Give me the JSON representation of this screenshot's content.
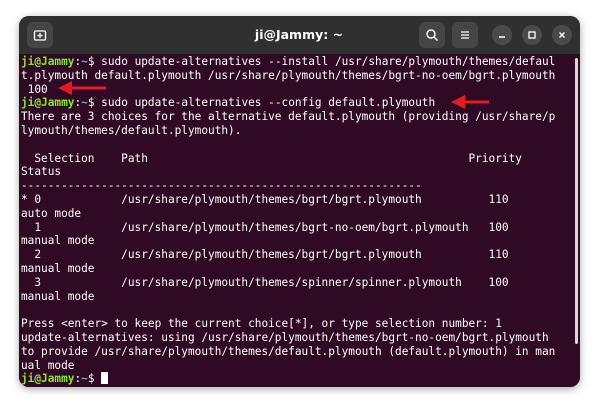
{
  "window": {
    "title": "ji@Jammy: ~"
  },
  "prompt": {
    "user": "ji@Jammy",
    "sep": ":",
    "path": "~",
    "symbol": "$"
  },
  "lines": [
    {
      "type": "cmd",
      "text": " sudo update-alternatives --install /usr/share/plymouth/themes/defaul"
    },
    {
      "type": "out",
      "text": "t.plymouth default.plymouth /usr/share/plymouth/themes/bgrt-no-oem/bgrt.plymouth"
    },
    {
      "type": "out",
      "text": " 100"
    },
    {
      "type": "cmd",
      "text": " sudo update-alternatives --config default.plymouth"
    },
    {
      "type": "out",
      "text": "There are 3 choices for the alternative default.plymouth (providing /usr/share/p"
    },
    {
      "type": "out",
      "text": "lymouth/themes/default.plymouth)."
    },
    {
      "type": "out",
      "text": ""
    },
    {
      "type": "out",
      "text": "  Selection    Path                                                Priority"
    },
    {
      "type": "out",
      "text": "Status"
    },
    {
      "type": "out",
      "text": "------------------------------------------------------------"
    },
    {
      "type": "out",
      "text": "* 0            /usr/share/plymouth/themes/bgrt/bgrt.plymouth          110"
    },
    {
      "type": "out",
      "text": "auto mode"
    },
    {
      "type": "out",
      "text": "  1            /usr/share/plymouth/themes/bgrt-no-oem/bgrt.plymouth   100"
    },
    {
      "type": "out",
      "text": "manual mode"
    },
    {
      "type": "out",
      "text": "  2            /usr/share/plymouth/themes/bgrt/bgrt.plymouth          110"
    },
    {
      "type": "out",
      "text": "manual mode"
    },
    {
      "type": "out",
      "text": "  3            /usr/share/plymouth/themes/spinner/spinner.plymouth    100"
    },
    {
      "type": "out",
      "text": "manual mode"
    },
    {
      "type": "out",
      "text": ""
    },
    {
      "type": "out",
      "text": "Press <enter> to keep the current choice[*], or type selection number: 1"
    },
    {
      "type": "out",
      "text": "update-alternatives: using /usr/share/plymouth/themes/bgrt-no-oem/bgrt.plymouth"
    },
    {
      "type": "out",
      "text": "to provide /usr/share/plymouth/themes/default.plymouth (default.plymouth) in man"
    },
    {
      "type": "out",
      "text": "ual mode"
    },
    {
      "type": "cmd",
      "text": " "
    }
  ],
  "icons": {
    "new_tab": "new-tab-icon",
    "search": "search-icon",
    "menu": "hamburger-menu-icon",
    "minimize": "minimize-icon",
    "maximize": "maximize-icon",
    "close": "close-icon"
  },
  "colors": {
    "terminal_bg": "#300a24",
    "titlebar_bg": "#303030",
    "prompt_user": "#8ae234",
    "prompt_path": "#729fcf",
    "annotation_arrow": "#e01b24"
  }
}
